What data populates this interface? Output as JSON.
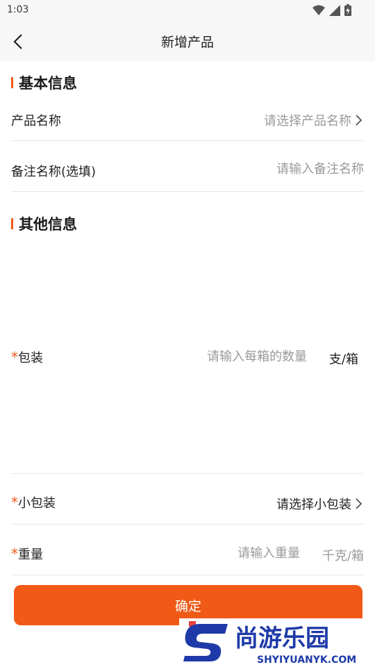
{
  "status_bar": {
    "time": "1:03"
  },
  "header": {
    "title": "新增产品"
  },
  "basic_section": {
    "title": "基本信息"
  },
  "product_name": {
    "label": "产品名称",
    "placeholder": "请选择产品名称"
  },
  "remark_name": {
    "label": "备注名称(选填)",
    "placeholder": "请输入备注名称"
  },
  "other_section": {
    "title": "其他信息"
  },
  "packaging": {
    "required_mark": "*",
    "label": "包装",
    "placeholder": "请输入每箱的数量",
    "unit": "支/箱"
  },
  "small_packaging": {
    "required_mark": "*",
    "label": "小包装",
    "value": "请选择小包装"
  },
  "weight": {
    "required_mark": "*",
    "label": "重量",
    "placeholder": "请输入重量",
    "unit": "千克/箱"
  },
  "confirm_button": {
    "label": "确定"
  },
  "watermark": {
    "brand": "尚游乐园",
    "site": "SHYIYUANYK.COM"
  },
  "colors": {
    "accent": "#f05a16",
    "divider": "#e8e8e8",
    "placeholder": "#9a9a9a"
  }
}
